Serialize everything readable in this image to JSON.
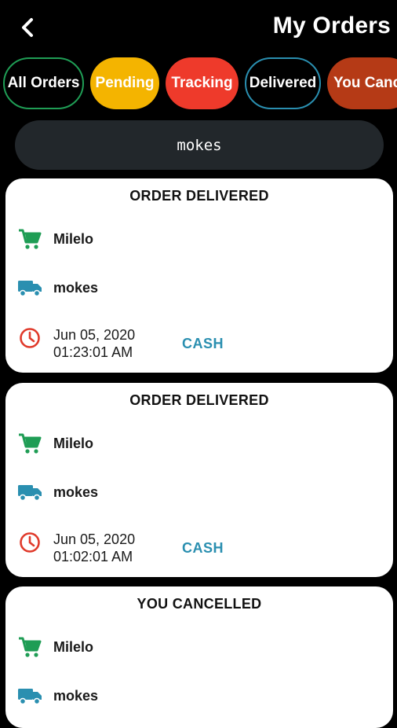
{
  "header": {
    "title": "My Orders",
    "back_icon": "back-chevron-icon"
  },
  "tabs": [
    {
      "label": "All Orders",
      "bg": "#000000",
      "border": "#1f9d55"
    },
    {
      "label": "Pending",
      "bg": "#f4b400",
      "border": "#f4b400"
    },
    {
      "label": "Tracking",
      "bg": "#ee3a2b",
      "border": "#ee3a2b"
    },
    {
      "label": "Delivered",
      "bg": "#000000",
      "border": "#2a8fb0"
    },
    {
      "label": "You Canc",
      "bg": "#b53a16",
      "border": "#b53a16"
    }
  ],
  "search": {
    "value": "mokes"
  },
  "colors": {
    "cart": "#1f9d55",
    "truck": "#2a8fb0",
    "clock": "#e03a2b",
    "payment": "#2a8fb0"
  },
  "orders": [
    {
      "status": "ORDER DELIVERED",
      "restaurant": "Milelo",
      "courier": "mokes",
      "date": "Jun 05, 2020",
      "time": "01:23:01 AM",
      "payment": "CASH"
    },
    {
      "status": "ORDER DELIVERED",
      "restaurant": "Milelo",
      "courier": "mokes",
      "date": "Jun 05, 2020",
      "time": "01:02:01 AM",
      "payment": "CASH"
    },
    {
      "status": "YOU CANCELLED",
      "restaurant": "Milelo",
      "courier": "mokes"
    }
  ]
}
